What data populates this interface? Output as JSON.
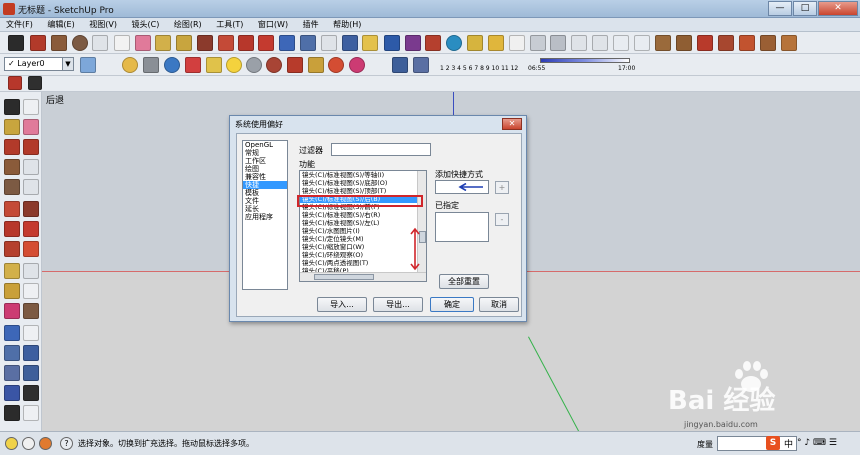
{
  "window": {
    "title": "无标题 - SketchUp Pro",
    "min": "—",
    "max": "□",
    "close": "✕"
  },
  "menu": [
    "文件(F)",
    "编辑(E)",
    "视图(V)",
    "镜头(C)",
    "绘图(R)",
    "工具(T)",
    "窗口(W)",
    "插件",
    "帮助(H)"
  ],
  "layer": {
    "name": "Layer0",
    "check": "✓"
  },
  "shadow_scale": {
    "hours": "1 2 3 4 5 6 7 8 9 10 11 12",
    "start_time": "06:55",
    "end_time": "17:00"
  },
  "canvas": {
    "label": "后退"
  },
  "status": {
    "text": "选择对象。切换到扩充选择。拖动鼠标选择多项。",
    "measure_label": "度量",
    "help_icon": "?"
  },
  "dialog": {
    "title": "系统使用偏好",
    "close": "✕",
    "categories": [
      {
        "label": "OpenGL",
        "selected": false
      },
      {
        "label": "常规",
        "selected": false
      },
      {
        "label": "工作区",
        "selected": false
      },
      {
        "label": "绘图",
        "selected": false
      },
      {
        "label": "兼容性",
        "selected": false
      },
      {
        "label": "快捷",
        "selected": true
      },
      {
        "label": "模板",
        "selected": false
      },
      {
        "label": "文件",
        "selected": false
      },
      {
        "label": "延长",
        "selected": false
      },
      {
        "label": "应用程序",
        "selected": false
      }
    ],
    "filter_label": "过滤器",
    "filter_value": "",
    "function_label": "功能",
    "functions": [
      {
        "label": "镜头(C)/标准视图(S)/等轴(I)",
        "selected": false
      },
      {
        "label": "镜头(C)/标准视图(S)/底部(O)",
        "selected": false
      },
      {
        "label": "镜头(C)/标准视图(S)/顶部(T)",
        "selected": false
      },
      {
        "label": "镜头(C)/标准视图(S)/后(B)",
        "selected": true
      },
      {
        "label": "镜头(C)/标准视图(S)/前(F)",
        "selected": false
      },
      {
        "label": "镜头(C)/标准视图(S)/右(R)",
        "selected": false
      },
      {
        "label": "镜头(C)/标准视图(S)/左(L)",
        "selected": false
      },
      {
        "label": "镜头(C)/水图图片(I)",
        "selected": false
      },
      {
        "label": "镜头(C)/定位镜头(M)",
        "selected": false
      },
      {
        "label": "镜头(C)/缩放窗口(W)",
        "selected": false
      },
      {
        "label": "镜头(C)/环绕观察(O)",
        "selected": false
      },
      {
        "label": "镜头(C)/两点透视图(T)",
        "selected": false
      },
      {
        "label": "镜头(C)/平移(P)",
        "selected": false
      }
    ],
    "add_shortcut_label": "添加快捷方式",
    "add_shortcut_value": "",
    "add_btn": "+",
    "assigned_label": "已指定",
    "remove_btn": "-",
    "reset_all": "全部重置",
    "import": "导入...",
    "export": "导出...",
    "ok": "确定",
    "cancel": "取消"
  },
  "watermark": {
    "brand": "Bai  经验",
    "site": "jingyan.baidu.com"
  },
  "tray": {
    "ime": "S",
    "lang": "中",
    "glyphs": "° ♪ ⌨ ☰"
  },
  "colors": {
    "selection": "#3399ff",
    "highlight_box": "#d0262b",
    "axis_red": "#d66b6b",
    "axis_green": "#34b24a",
    "axis_blue": "#3a4ec0"
  }
}
